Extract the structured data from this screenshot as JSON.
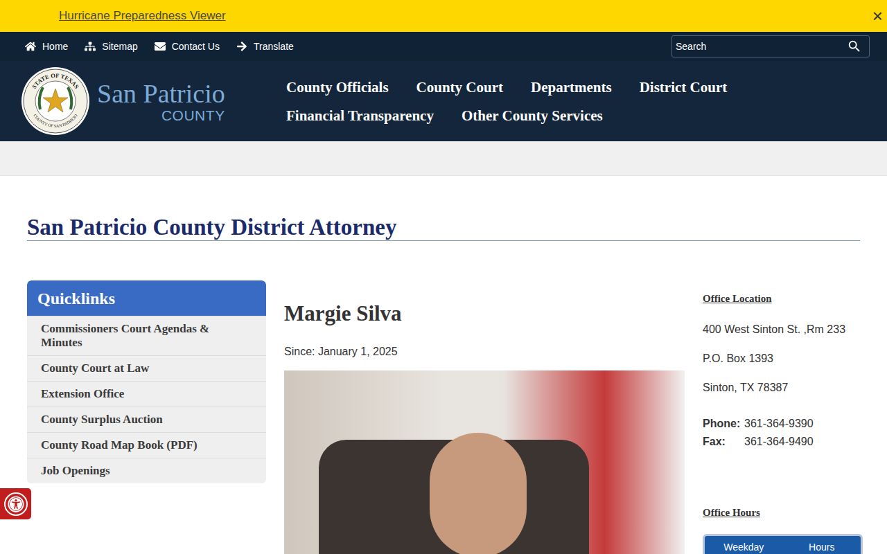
{
  "banner": {
    "link": "Hurricane Preparedness Viewer",
    "close": "×"
  },
  "utility_nav": [
    {
      "label": "Home"
    },
    {
      "label": "Sitemap"
    },
    {
      "label": "Contact Us"
    },
    {
      "label": "Translate"
    }
  ],
  "search": {
    "placeholder": "Search"
  },
  "logo": {
    "seal_top": "STATE OF TEXAS",
    "seal_bottom": "COUNTY OF SAN PATRICIO",
    "name": "San Patricio",
    "sub": "COUNTY"
  },
  "main_nav": [
    [
      "County Officials",
      "County Court",
      "Departments",
      "District Court"
    ],
    [
      "Financial Transparency",
      "Other County Services"
    ]
  ],
  "page_title": "San Patricio County District Attorney",
  "quicklinks": {
    "title": "Quicklinks",
    "items": [
      "Commissioners Court Agendas & Minutes",
      "County Court at Law",
      "Extension Office",
      "County Surplus Auction",
      "County Road Map Book (PDF)",
      "Job Openings"
    ]
  },
  "official": {
    "name": "Margie Silva",
    "since": "Since: January 1, 2025"
  },
  "office_location": {
    "heading": "Office Location",
    "address": [
      "400 West Sinton St. ,Rm 233",
      "P.O. Box 1393",
      "Sinton, TX 78387"
    ],
    "phone_label": "Phone:",
    "phone": "361-364-9390",
    "fax_label": "Fax:",
    "fax": "361-364-9490"
  },
  "office_hours": {
    "heading": "Office Hours",
    "columns": [
      "Weekday",
      "Hours"
    ]
  }
}
